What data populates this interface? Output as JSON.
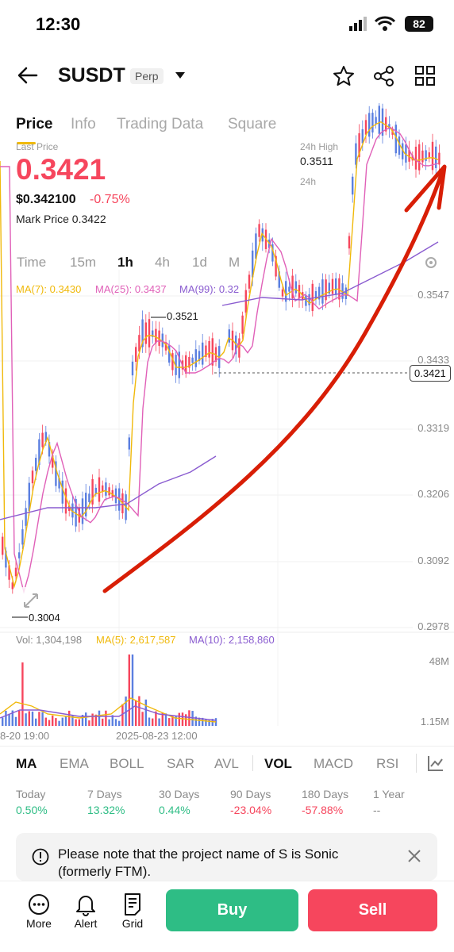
{
  "status": {
    "time": "12:30",
    "battery": "82"
  },
  "header": {
    "symbol": "SUSDT",
    "type_badge": "Perp"
  },
  "tabs": [
    {
      "label": "Price",
      "active": true
    },
    {
      "label": "Info"
    },
    {
      "label": "Trading Data"
    },
    {
      "label": "Square"
    }
  ],
  "price": {
    "last_label": "Last Price",
    "last_price": "0.3421",
    "usd": "$0.342100",
    "change": "-0.75%",
    "mark_label": "Mark Price",
    "mark_value": "0.3422",
    "h24_label": "24h High",
    "h24_value": "0.3511",
    "h24_next_label": "24h"
  },
  "timeframes": [
    "Time",
    "15m",
    "1h",
    "4h",
    "1d",
    "M"
  ],
  "active_timeframe": "1h",
  "ma_legend": {
    "ma7": "MA(7): 0.3430",
    "ma25": "MA(25): 0.3437",
    "ma99": "MA(99): 0.32"
  },
  "chart_data": {
    "type": "candlestick",
    "price_axis_ticks": [
      "0.3547",
      "0.3433",
      "0.3319",
      "0.3206",
      "0.3092",
      "0.2978"
    ],
    "current_price_tag": "0.3421",
    "annotations": {
      "high": "0.3521",
      "low": "0.3004"
    },
    "x_labels": [
      "8-20 19:00",
      "2025-08-23 12:00"
    ],
    "volume_axis_ticks": [
      "48M",
      "1.15M"
    ],
    "colors": {
      "up": "#f6465d",
      "down": "#5b7fe0",
      "ma7": "#f0b90b",
      "ma25": "#e060b8",
      "ma99": "#8a5cd0",
      "arrow": "#d81e06"
    }
  },
  "vol_legend": {
    "vol": "Vol: 1,304,198",
    "ma5": "MA(5): 2,617,587",
    "ma10": "MA(10): 2,158,860"
  },
  "indicators": [
    "MA",
    "EMA",
    "BOLL",
    "SAR",
    "AVL",
    "VOL",
    "MACD",
    "RSI"
  ],
  "active_indicators": [
    "MA",
    "VOL"
  ],
  "performance": [
    {
      "label": "Today",
      "value": "0.50%",
      "color": "#2ebd85"
    },
    {
      "label": "7 Days",
      "value": "13.32%",
      "color": "#2ebd85"
    },
    {
      "label": "30 Days",
      "value": "0.44%",
      "color": "#2ebd85"
    },
    {
      "label": "90 Days",
      "value": "-23.04%",
      "color": "#f6465d"
    },
    {
      "label": "180 Days",
      "value": "-57.88%",
      "color": "#f6465d"
    },
    {
      "label": "1 Year",
      "value": "--",
      "color": "#8a8a8a"
    }
  ],
  "notice": {
    "text": "Please note that the project name of S is Sonic (formerly FTM)."
  },
  "bottom": {
    "more": "More",
    "alert": "Alert",
    "grid": "Grid",
    "buy": "Buy",
    "sell": "Sell"
  }
}
